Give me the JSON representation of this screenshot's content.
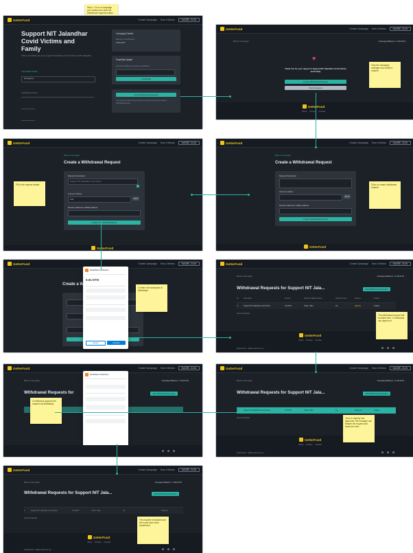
{
  "brand": {
    "name": "GetterFund",
    "color_primary": "#f0c419",
    "accent": "#2bb3a3"
  },
  "nav": {
    "link1": "Create Campaign",
    "link2": "How It Works",
    "account": "0xA3f9...2c1b"
  },
  "frame1": {
    "title_line1": "Support NIT Jalandhar",
    "title_line2": "Covid Victims and",
    "title_line3": "Family",
    "description": "This is a fundraiser set up to support the families of Covid victims at NIT Jalandhar.",
    "link_text": "View Wallet Details",
    "field_value": "Emergency",
    "sub_label": "Contributors Count",
    "side_card_title": "Campaign Details",
    "side_card_line1": "Minimum Contribution",
    "side_card_line2": "0.001 ETH",
    "fund_card_title": "Fund this Cause!",
    "fund_card_label": "Amount in Ether you want to contribute",
    "fund_button": "Contribute",
    "withdraw_button": "View Withdrawal Requests",
    "withdraw_note": "You can see where these funds are being used and request withdrawals here",
    "sticky": "Go to the campaign page and click on view withdrawal requests"
  },
  "frame2": {
    "back": "Back to Campaign",
    "balance": "Campaign Balance : 0.012 ETH",
    "thanks": "Thank You for your support to Support NIT Jalandhar Covid Victims and Family",
    "btn1": "Create Withdrawal Request",
    "btn2": "View Requests",
    "sticky": "Only the campaign manager can create a request",
    "footer_links": [
      "About",
      "Privacy",
      "Contact"
    ]
  },
  "frame3": {
    "back": "Back to Campaign",
    "title": "Create a Withdrawal Request",
    "f1": "Request Description",
    "f1_value": "Support NIT Jalandhar Covid Victims",
    "f2": "Amount in Ether",
    "f2_value": "0.01",
    "f3": "Receiver Ethereum Wallet Address",
    "button": "Create Withdrawal Request",
    "sticky": "Fill in the request details"
  },
  "frame4": {
    "back": "Back to Campaign",
    "title": "Create a Withdrawal Request",
    "f1": "Request Description",
    "f2": "Amount in Ether",
    "f3": "Receiver Ethereum Wallet Address",
    "button": "Create Withdrawal Request",
    "sticky": "Click on create withdrawal request"
  },
  "frame5": {
    "title": "Create a Withdrawal Request",
    "wallet_title": "MetaMask Notification",
    "wallet_amount": "0.01 ETH",
    "wallet_reject": "Reject",
    "wallet_confirm": "Confirm",
    "sticky": "Confirm the transaction in MetaMask"
  },
  "frame6": {
    "back": "Back to Campaign",
    "balance": "Campaign Balance : 0.012 ETH",
    "title": "Withdrawal Requests for Support NIT Jala...",
    "add_button": "Add Withdrawal Request",
    "columns": [
      "ID",
      "Description",
      "Amount",
      "Recipient Wallet Address",
      "Approval Count",
      "Approve",
      "Finalize"
    ],
    "row": [
      "0",
      "Support NIT Jalandhar Covid Victims",
      "0.01 ETH",
      "0x7a2...9d1e",
      "0/1",
      "Approve",
      "Finalize"
    ],
    "extra": "Show Finalized",
    "sticky": "The withdrawal request will be listed here. Contributors can approve it.",
    "bottom_left": "GetterFund · Made with love by ...",
    "footer_links": [
      "About",
      "Privacy",
      "Contact"
    ]
  },
  "frame7": {
    "back": "Back to Campaign",
    "balance": "Campaign Balance : 0.012 ETH",
    "title": "Withdrawal Requests for",
    "add_button": "Add Withdrawal Request",
    "wallet_title": "MetaMask Notification",
    "wallet_reject": "Reject",
    "wallet_confirm": "Confirm",
    "sticky": "Contributors approve the request via MetaMask"
  },
  "frame8": {
    "back": "Back to Campaign",
    "balance": "Campaign Balance : 0.012 ETH",
    "title": "Withdrawal Requests for Support NIT Jala...",
    "add_button": "Add Withdrawal Request",
    "row": [
      "0",
      "Support NIT Jalandhar Covid Victims",
      "0.01 ETH",
      "0x7a2...9d1e",
      "1/1",
      "Approved",
      "Finalize"
    ],
    "extra": "Show Finalized",
    "sticky": "Once a majority has approved, the manager can finalize the request and funds are sent.",
    "bottom_left": "GetterFund · Made with love by ...",
    "footer_links": [
      "About",
      "Privacy",
      "Contact"
    ]
  },
  "frame9": {
    "back": "Back to Campaign",
    "balance": "Campaign Balance : 0.002 ETH",
    "title": "Withdrawal Requests for Support NIT Jala...",
    "add_button": "Add Withdrawal Request",
    "row": [
      "0",
      "Support NIT Jalandhar Covid Victims",
      "0.01 ETH",
      "0x7a2...9d1e",
      "1/1",
      "",
      "Finalized"
    ],
    "extra": "Show Finalized",
    "sticky": "The request is finalized and the funds have been transferred.",
    "bottom_left": "GetterFund · Made with love by ...",
    "footer_links": [
      "About",
      "Privacy",
      "Contact"
    ]
  },
  "top_sticky": "Step 1: Go to a campaign you created and click the withdrawal requests button"
}
